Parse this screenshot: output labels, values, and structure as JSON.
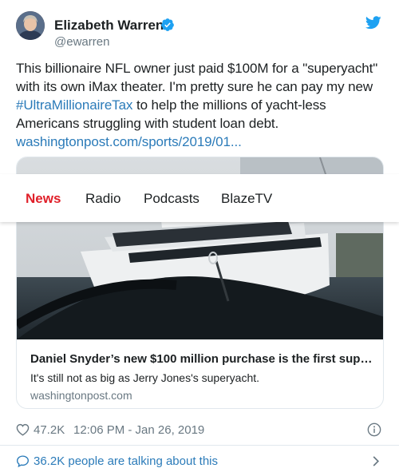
{
  "author": {
    "name": "Elizabeth Warren",
    "handle": "@ewarren"
  },
  "tweet": {
    "text_1": "This billionaire NFL owner just paid $100M for a \"superyacht\" with its own iMax theater. I'm pretty sure he can pay my new ",
    "hashtag": "#UltraMillionaireTax",
    "text_2": " to help the millions of yacht-less Americans struggling with student loan debt. ",
    "link": "washingtonpost.com/sports/2019/01..."
  },
  "nav": {
    "items": [
      "News",
      "Radio",
      "Podcasts",
      "BlazeTV"
    ],
    "active": "News"
  },
  "card": {
    "title": "Daniel Snyder’s new $100 million purchase is the first supe...",
    "description": "It's still not as big as Jerry Jones's superyacht.",
    "domain": "washingtonpost.com"
  },
  "meta": {
    "likes": "47.2K",
    "timestamp": "12:06 PM - Jan 26, 2019"
  },
  "footer": {
    "talking": "36.2K people are talking about this"
  },
  "colors": {
    "link": "#2b7bb9",
    "nav_active": "#e0202a",
    "twitter_blue": "#1da1f2"
  },
  "icons": [
    "verified-badge-icon",
    "twitter-bird-icon",
    "heart-icon",
    "info-icon",
    "speech-bubble-icon",
    "chevron-right-icon"
  ]
}
